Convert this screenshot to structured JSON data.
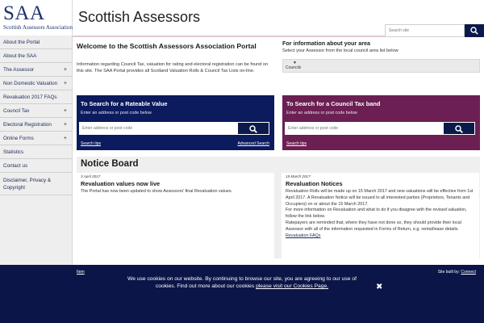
{
  "header": {
    "logo": "SAA",
    "logo_sub": "Scottish Assessors Association",
    "title": "Scottish Assessors",
    "search_placeholder": "Search site"
  },
  "sidebar": {
    "items": [
      {
        "label": "About the Portal",
        "expandable": false
      },
      {
        "label": "About the SAA",
        "expandable": false
      },
      {
        "label": "The Assessor",
        "expandable": true
      },
      {
        "label": "Non Domestic Valuation",
        "expandable": true
      },
      {
        "label": "Revaluation 2017 FAQs",
        "expandable": false
      },
      {
        "label": "Council Tax",
        "expandable": true
      },
      {
        "label": "Electoral Registration",
        "expandable": true
      },
      {
        "label": "Online Forms",
        "expandable": true
      },
      {
        "label": "Statistics",
        "expandable": false
      },
      {
        "label": "Contact us",
        "expandable": false
      },
      {
        "label": "Disclaimer, Privacy & Copyright",
        "expandable": false
      }
    ],
    "plus_glyph": "+"
  },
  "welcome": {
    "title": "Welcome to the Scottish Assessors Association Portal",
    "body": "Information regarding Council Tax, valuation for rating and electoral registration can be found on this site. The SAA Portal provides all Scotland Valuation Rolls & Council Tax Lists on-line."
  },
  "area_info": {
    "title": "For information about your area",
    "subtitle": "Select your Assessor from the local council area list below",
    "select_value": "Councils"
  },
  "rateable": {
    "title": "To Search for a Rateable Value",
    "subtitle": "Enter an address or post code below",
    "placeholder": "Enter address or post code",
    "tips_link": "Search tips",
    "advanced_link": "Advanced Search",
    "color": "#0c1a5e"
  },
  "council_tax": {
    "title": "To Search for a Council Tax band",
    "subtitle": "Enter an address or post code below",
    "placeholder": "Enter address or post code",
    "tips_link": "Search tips",
    "color": "#6b1f52"
  },
  "notice_board": {
    "title": "Notice Board",
    "items": [
      {
        "date": "3 April 2017",
        "heading": "Revaluation values now live",
        "paragraphs": [
          "The Portal has now been updated to show Assessors' final Revaluation values."
        ],
        "link": ""
      },
      {
        "date": "15 March 2017",
        "heading": "Revaluation Notices",
        "paragraphs": [
          "Revaluation Rolls will be made up on 15 March 2017 and new valuations will be effective from 1st April 2017. A Revaluation Notice will be issued to all interested parties (Proprietors, Tenants and Occupiers) on or about the 15 March 2017.",
          "For more information on Revaluation and what to do if you disagree with the revised valuation, follow the link below.",
          "Ratepayers are reminded that, where they have not done so, they should provide their local Assessor with all of the information requested in Forms of Return, e.g. rental/lease details."
        ],
        "link": "Revaluation FAQs"
      }
    ]
  },
  "footer": {
    "left_link": "Item",
    "site_built_by": "Site built by:",
    "builder_link": "Connect",
    "cookie_text": "We use cookies on our website. By continuing to browse our site, you are agreeing to our use of cookies. Find out more about our cookies",
    "cookie_link": "please visit our Cookies Page.",
    "close_glyph": "✖"
  },
  "colors": {
    "navy": "#0b1548",
    "purple": "#6b1f52",
    "sidebar_bg": "#eeeeee"
  }
}
